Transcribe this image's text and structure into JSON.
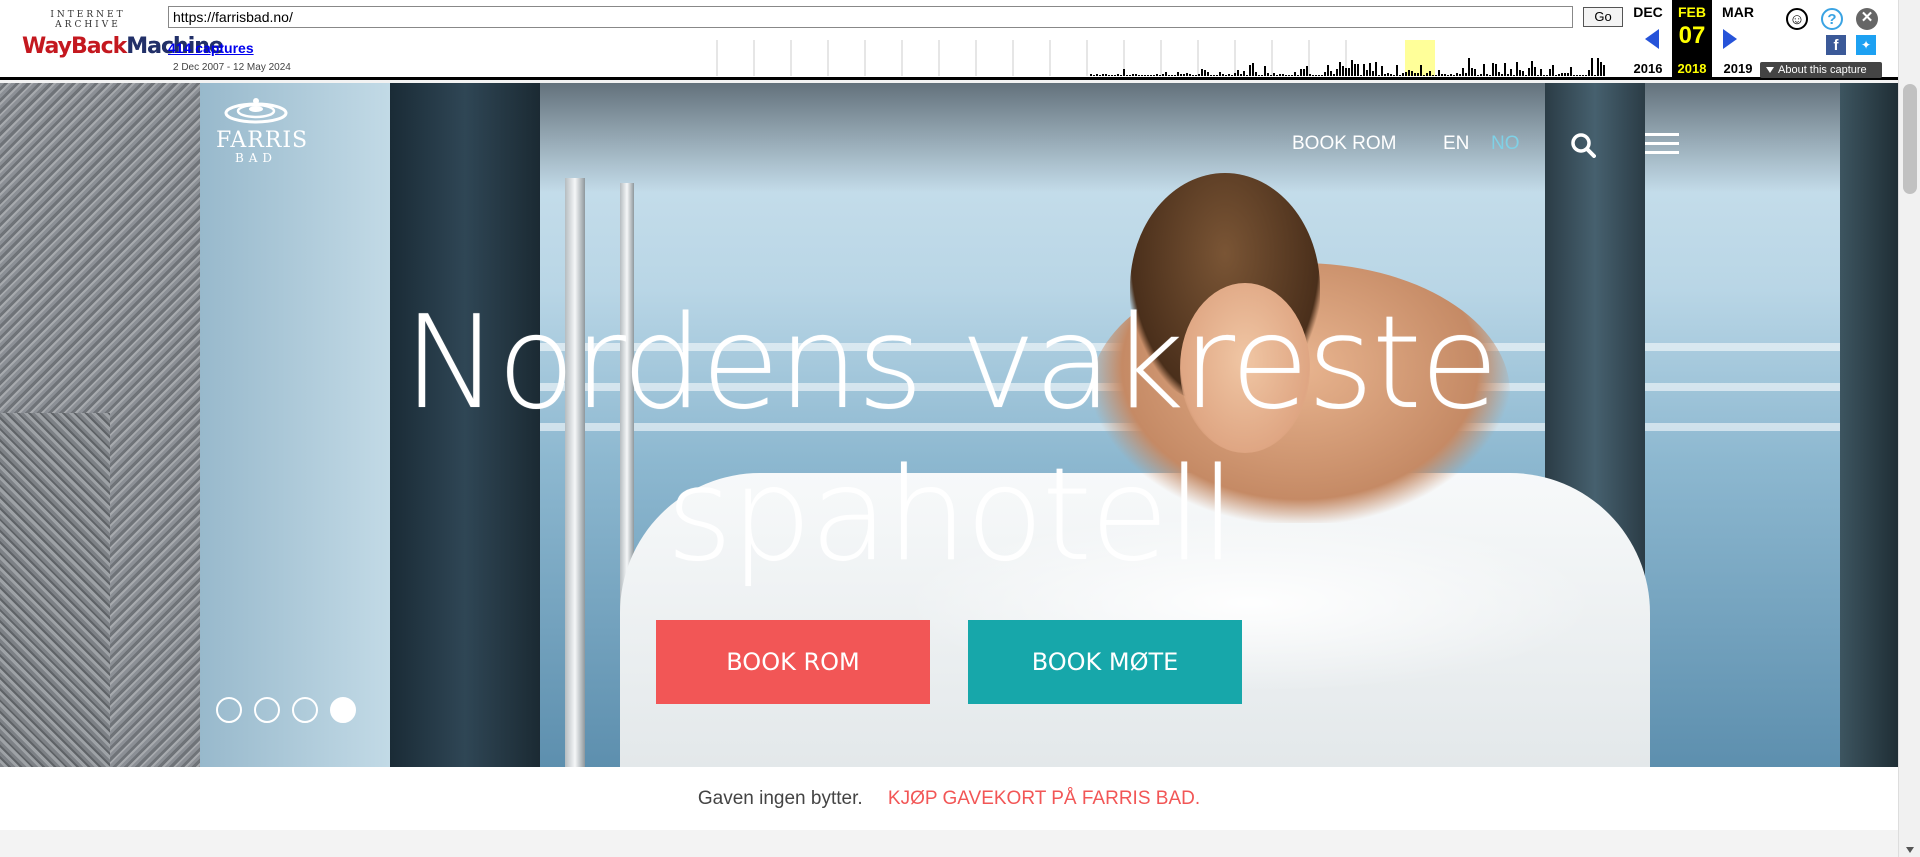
{
  "wayback": {
    "brand_top": "INTERNET ARCHIVE",
    "brand_main_1": "WayBack",
    "brand_main_2": "Machine",
    "url_value": "https://farrisbad.no/",
    "go_label": "Go",
    "captures_label": "414 captures",
    "date_range": "2 Dec 2007 - 12 May 2024",
    "prev": {
      "month": "DEC",
      "year": "2016"
    },
    "current": {
      "month": "FEB",
      "day": "07",
      "year": "2018"
    },
    "next": {
      "month": "MAR",
      "year": "2019"
    },
    "about_label": "About this capture",
    "icons": [
      "user-icon",
      "help-icon",
      "close-icon",
      "facebook-icon",
      "twitter-icon"
    ]
  },
  "nav": {
    "logo_name": "FARRIS",
    "logo_sub": "BAD",
    "book_label": "BOOK ROM",
    "lang_en": "EN",
    "lang_no": "NO",
    "icons": [
      "search-icon",
      "hamburger-menu-icon"
    ]
  },
  "hero": {
    "headline_line1": "Nordens vakreste",
    "headline_line2": "spahotell",
    "cta_room": "BOOK ROM",
    "cta_meeting": "BOOK MØTE",
    "slides_total": 4,
    "slide_active": 4
  },
  "promo": {
    "lead": "Gaven ingen bytter.",
    "link": "KJØP GAVEKORT PÅ FARRIS BAD."
  },
  "colors": {
    "accent_red": "#f25656",
    "accent_teal": "#17a7aa",
    "lang_active": "#7fd1e6",
    "wayback_current": "#ffff00"
  }
}
